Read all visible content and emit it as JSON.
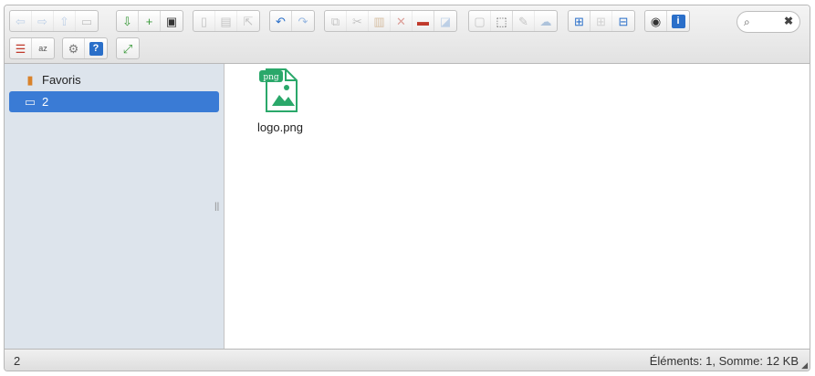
{
  "toolbar": {
    "groups": [
      [
        {
          "icon": "back-icon",
          "glyph": "⇦",
          "color": "#7ea6d8",
          "enabled": false
        },
        {
          "icon": "forward-icon",
          "glyph": "⇨",
          "color": "#7ea6d8",
          "enabled": false
        },
        {
          "icon": "up-icon",
          "glyph": "⇧",
          "color": "#7ea6d8",
          "enabled": false
        },
        {
          "icon": "reload-icon",
          "glyph": "▭",
          "color": "#888888",
          "enabled": false
        }
      ],
      [
        {
          "icon": "new-folder-icon",
          "glyph": "⇩",
          "color": "#3a9a3a",
          "enabled": true
        },
        {
          "icon": "new-file-icon",
          "glyph": "+",
          "color": "#3a9a3a",
          "enabled": true
        },
        {
          "icon": "save-icon",
          "glyph": "▣",
          "color": "#333333",
          "enabled": true
        }
      ],
      [
        {
          "icon": "open-icon",
          "glyph": "▯",
          "color": "#888888",
          "enabled": false
        },
        {
          "icon": "download-icon",
          "glyph": "▤",
          "color": "#888888",
          "enabled": false
        },
        {
          "icon": "select-icon",
          "glyph": "⇱",
          "color": "#888888",
          "enabled": false
        }
      ],
      [
        {
          "icon": "undo-icon",
          "glyph": "↶",
          "color": "#2a6fc9",
          "enabled": true
        },
        {
          "icon": "redo-icon",
          "glyph": "↷",
          "color": "#2a6fc9",
          "enabled": false
        }
      ],
      [
        {
          "icon": "copy-icon",
          "glyph": "⧉",
          "color": "#888888",
          "enabled": false
        },
        {
          "icon": "cut-icon",
          "glyph": "✂",
          "color": "#888888",
          "enabled": false
        },
        {
          "icon": "paste-icon",
          "glyph": "▥",
          "color": "#b07a3a",
          "enabled": false
        },
        {
          "icon": "delete-icon",
          "glyph": "✕",
          "color": "#c0392b",
          "enabled": false
        },
        {
          "icon": "empty-icon",
          "glyph": "▬",
          "color": "#c0392b",
          "enabled": true
        },
        {
          "icon": "duplicate-icon",
          "glyph": "◪",
          "color": "#7ea6d8",
          "enabled": false
        }
      ],
      [
        {
          "icon": "rename-icon",
          "glyph": "▢",
          "color": "#888888",
          "enabled": false
        },
        {
          "icon": "select-all-icon",
          "glyph": "⬚",
          "color": "#555555",
          "enabled": true
        },
        {
          "icon": "edit-icon",
          "glyph": "✎",
          "color": "#888888",
          "enabled": false
        },
        {
          "icon": "network-icon",
          "glyph": "☁",
          "color": "#5a8ac0",
          "enabled": false
        }
      ],
      [
        {
          "icon": "icons-view-icon",
          "glyph": "⊞",
          "color": "#2a6fc9",
          "enabled": true
        },
        {
          "icon": "list-view-icon",
          "glyph": "⊞",
          "color": "#aaaaaa",
          "enabled": false
        },
        {
          "icon": "details-view-icon",
          "glyph": "⊟",
          "color": "#2a6fc9",
          "enabled": true
        }
      ],
      [
        {
          "icon": "preview-icon",
          "glyph": "◉",
          "color": "#333333",
          "enabled": true
        },
        {
          "icon": "info-icon",
          "glyph": "i",
          "color": "#ffffff",
          "bg": "#2a6fc9",
          "enabled": true
        }
      ],
      [
        {
          "icon": "sort-icon",
          "glyph": "☰",
          "color": "#c0392b",
          "enabled": true
        },
        {
          "icon": "az-icon",
          "glyph": "az",
          "color": "#555555",
          "enabled": true
        }
      ],
      [
        {
          "icon": "settings-icon",
          "glyph": "⚙",
          "color": "#777777",
          "enabled": true
        },
        {
          "icon": "help-icon",
          "glyph": "?",
          "color": "#ffffff",
          "bg": "#2a6fc9",
          "enabled": true
        }
      ],
      [
        {
          "icon": "fullscreen-icon",
          "glyph": "⤢",
          "color": "#3a9a3a",
          "enabled": true
        }
      ]
    ]
  },
  "search": {
    "placeholder": "",
    "search_glyph": "⌕",
    "clear_glyph": "✖"
  },
  "sidebar": {
    "items": [
      {
        "label": "Favoris",
        "icon": "favorites-icon",
        "glyph": "▮",
        "selected": false
      },
      {
        "label": "2",
        "icon": "drive-icon",
        "glyph": "▭",
        "selected": true
      }
    ],
    "handle_glyph": "||"
  },
  "files": [
    {
      "name": "logo.png",
      "type_badge": "png",
      "icon": "image-file-icon",
      "badge_color": "#2aa86a"
    }
  ],
  "statusbar": {
    "left": "2",
    "right": "Éléments: 1, Somme: 12 KB",
    "grip": "◢"
  }
}
